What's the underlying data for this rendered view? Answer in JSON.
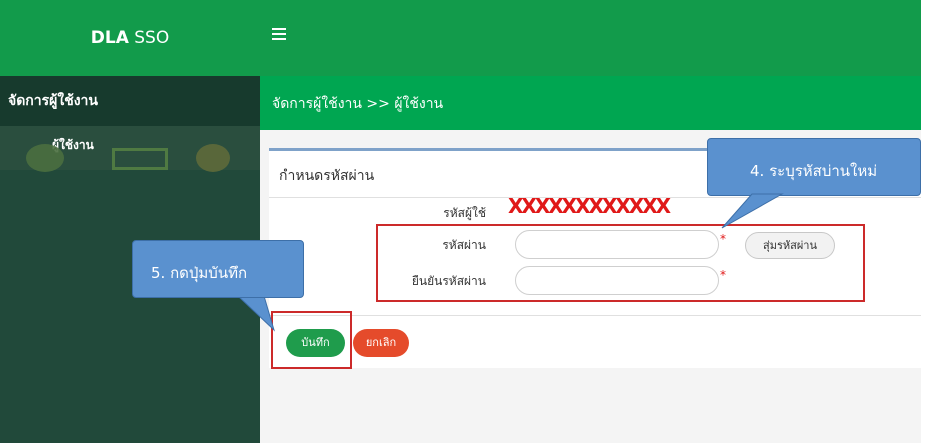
{
  "app": {
    "brand_bold": "DLA",
    "brand_rest": " SSO"
  },
  "sidebar": {
    "header": "จัดการผู้ใช้งาน",
    "items": [
      {
        "label": "ผู้ใช้งาน"
      }
    ]
  },
  "breadcrumb": "จัดการผู้ใช้งาน >> ผู้ใช้งาน",
  "panel": {
    "title": "กำหนดรหัสผ่าน",
    "username_label": "รหัสผู้ใช้",
    "username_value": "XXXXXXXXXXXX",
    "password_label": "รหัสผ่าน",
    "password_value": "",
    "confirm_label": "ยืนยันรหัสผ่าน",
    "confirm_value": "",
    "required_mark": "*",
    "generate_label": "สุ่มรหัสผ่าน"
  },
  "buttons": {
    "save": "บันทึก",
    "cancel": "ยกเลิก"
  },
  "annotations": {
    "step4": "4. ระบุรหัสบ่านใหม่",
    "step5": "5. กดปุ่มบันทึก"
  },
  "colors": {
    "topbar": "#129b4b",
    "header_green": "#00a651",
    "sidebar": "#21493a",
    "save": "#1f9c4c",
    "cancel": "#e54b2b",
    "callout": "#5a91cf",
    "highlight": "#cc2a2a"
  }
}
